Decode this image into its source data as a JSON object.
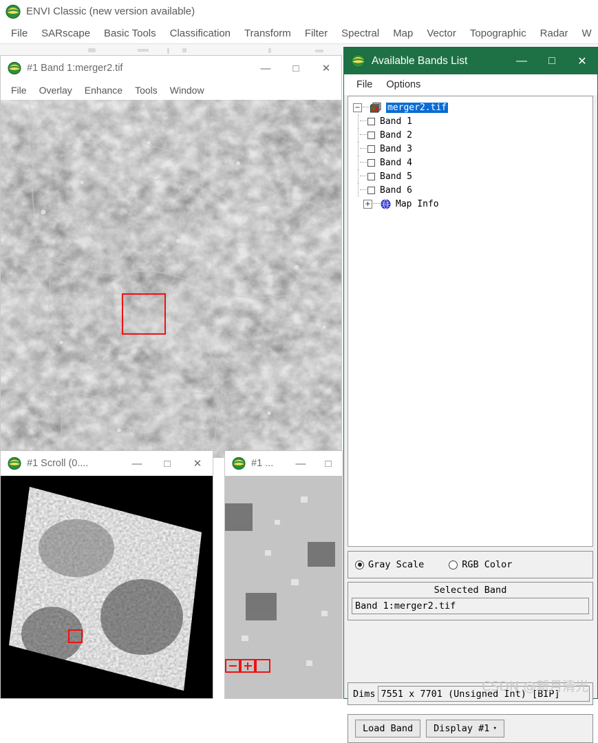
{
  "app": {
    "title": "ENVI Classic (new version available)",
    "menu": [
      "File",
      "SARscape",
      "Basic Tools",
      "Classification",
      "Transform",
      "Filter",
      "Spectral",
      "Map",
      "Vector",
      "Topographic",
      "Radar",
      "W"
    ]
  },
  "image_window": {
    "title": "#1 Band 1:merger2.tif",
    "menu": [
      "File",
      "Overlay",
      "Enhance",
      "Tools",
      "Window"
    ],
    "controls": {
      "minimize": "—",
      "maximize": "□",
      "close": "✕"
    }
  },
  "scroll_window": {
    "title": "#1 Scroll (0....",
    "controls": {
      "minimize": "—",
      "maximize": "□",
      "close": "✕"
    }
  },
  "zoom_window": {
    "title": "#1 ...",
    "controls": {
      "minimize": "—",
      "maximize": "□"
    },
    "zoom_controls": [
      "zoom-out-box",
      "zoom-in-box",
      "select-box"
    ]
  },
  "bands_list": {
    "title": "Available Bands List",
    "controls": {
      "minimize": "—",
      "maximize": "□",
      "close": "✕"
    },
    "menu": [
      "File",
      "Options"
    ],
    "tree": {
      "root": {
        "label": "merger2.tif",
        "expander": "−",
        "selected": true
      },
      "bands": [
        "Band 1",
        "Band 2",
        "Band 3",
        "Band 4",
        "Band 5",
        "Band 6"
      ],
      "map_info": {
        "label": "Map Info",
        "expander": "+"
      }
    },
    "color_mode": {
      "options": [
        {
          "label": "Gray Scale",
          "selected": true
        },
        {
          "label": "RGB Color",
          "selected": false
        }
      ]
    },
    "selected_band": {
      "caption": "Selected Band",
      "value": "Band 1:merger2.tif"
    },
    "dims": {
      "label": "Dims",
      "value": "7551 x 7701 (Unsigned Int) [BIP]"
    },
    "actions": {
      "load_band": "Load Band",
      "display": "Display #1",
      "display_caret": "▾"
    }
  },
  "watermark": "CSDN @新月清光",
  "colors": {
    "title_green": "#1e7145",
    "selection_blue": "#0a6cd4",
    "red_box": "#ee1111",
    "panel_gray": "#f0f0f0"
  }
}
